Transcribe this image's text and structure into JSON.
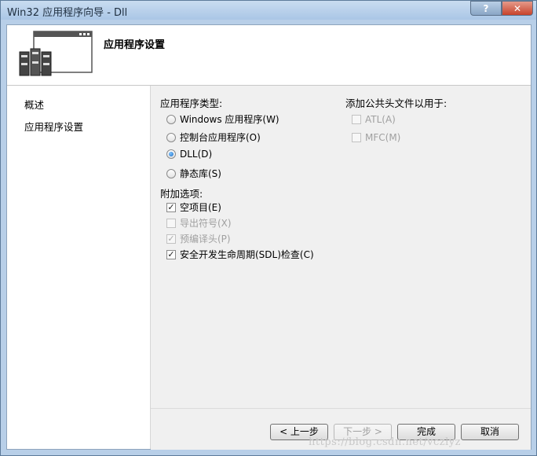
{
  "window": {
    "title": "Win32 应用程序向导 - Dll",
    "help_label": "?",
    "close_label": "✕"
  },
  "header": {
    "title": "应用程序设置"
  },
  "nav": {
    "items": [
      "概述",
      "应用程序设置"
    ]
  },
  "app_type": {
    "label": "应用程序类型:",
    "options": [
      {
        "label": "Windows 应用程序(W)",
        "checked": false
      },
      {
        "label": "控制台应用程序(O)",
        "checked": false
      },
      {
        "label": "DLL(D)",
        "checked": true
      },
      {
        "label": "静态库(S)",
        "checked": false
      }
    ]
  },
  "extra_options": {
    "label": "附加选项:",
    "options": [
      {
        "label": "空项目(E)",
        "checked": true,
        "enabled": true
      },
      {
        "label": "导出符号(X)",
        "checked": false,
        "enabled": false
      },
      {
        "label": "预编译头(P)",
        "checked": true,
        "enabled": false
      },
      {
        "label": "安全开发生命周期(SDL)检查(C)",
        "checked": true,
        "enabled": true
      }
    ]
  },
  "common_headers": {
    "label": "添加公共头文件以用于:",
    "options": [
      {
        "label": "ATL(A)",
        "checked": false,
        "enabled": false
      },
      {
        "label": "MFC(M)",
        "checked": false,
        "enabled": false
      }
    ]
  },
  "footer": {
    "prev": "< 上一步",
    "next": "下一步 >",
    "finish": "完成",
    "cancel": "取消"
  },
  "watermark": "https://blog.csdn.net/vczlyz",
  "colors": {
    "accent": "#1f6fc4",
    "frame": "#b8cfe8"
  }
}
